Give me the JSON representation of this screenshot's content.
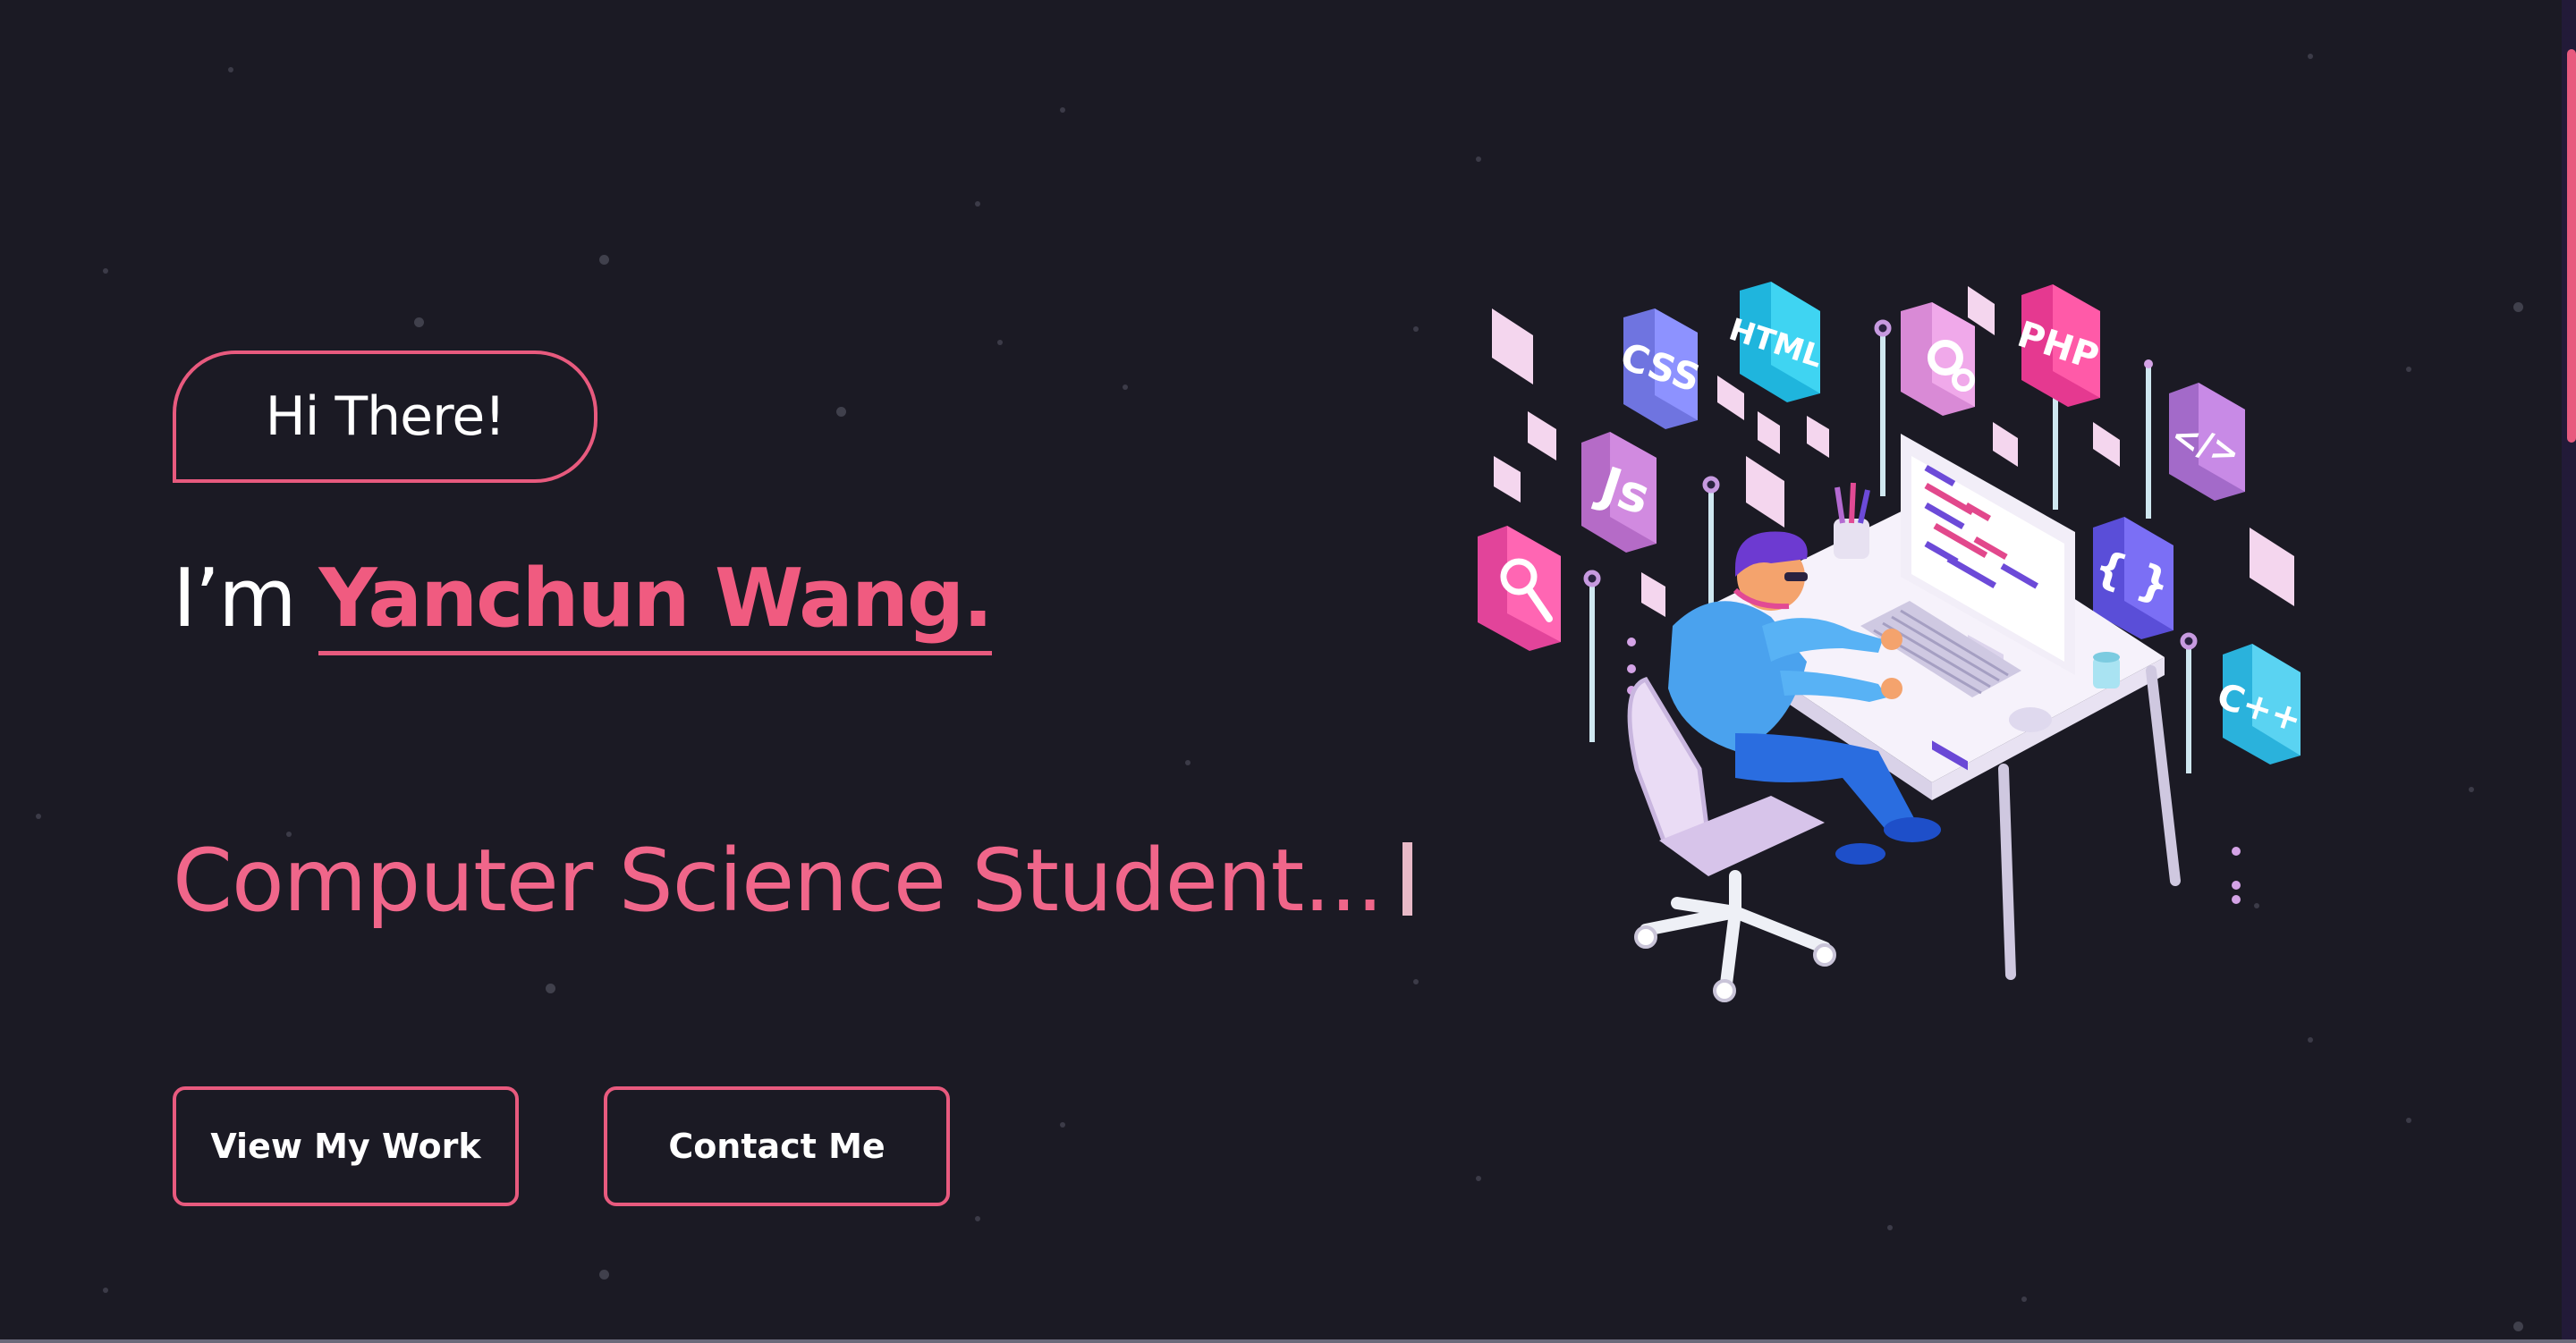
{
  "hero": {
    "greeting": "Hi There!",
    "intro_prefix": "I’m",
    "name": "Yanchun Wang.",
    "role": "Computer Science Student..."
  },
  "actions": {
    "view_work": "View My Work",
    "contact": "Contact Me"
  },
  "illustration": {
    "tiles": [
      "CSS",
      "HTML",
      "PHP",
      "Js",
      "</>",
      "{ }",
      "C++"
    ]
  },
  "colors": {
    "background": "#1b1a24",
    "accent": "#e85a7e",
    "text": "#ffffff"
  }
}
